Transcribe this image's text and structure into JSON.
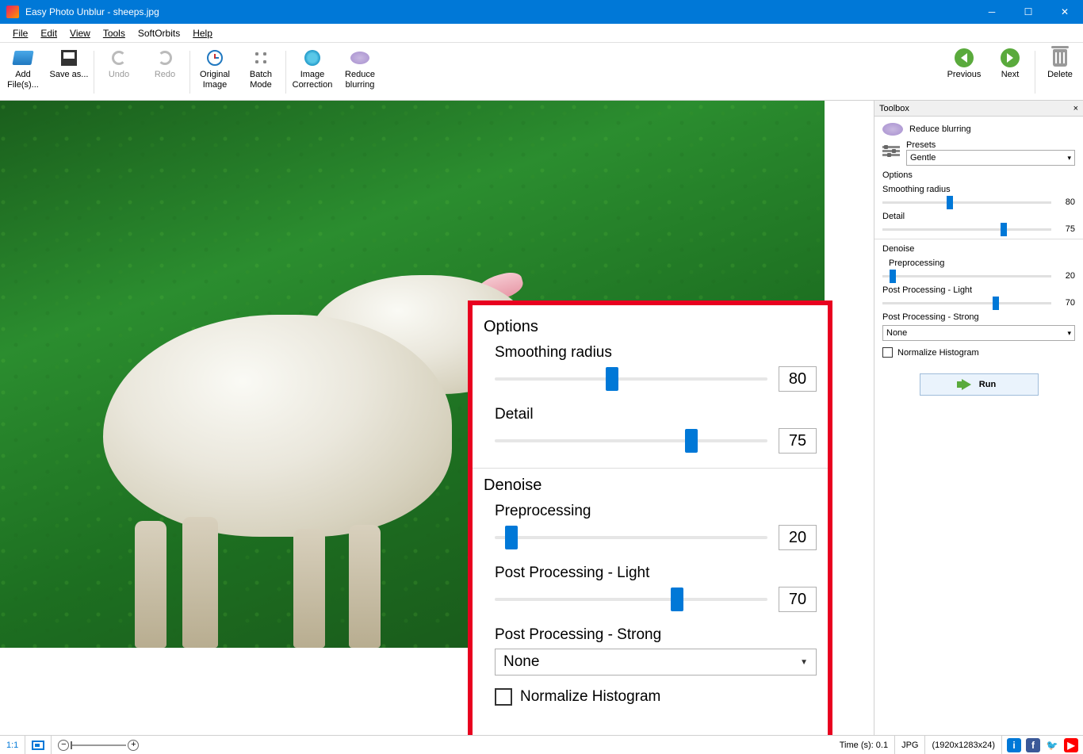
{
  "titlebar": {
    "title": "Easy Photo Unblur - sheeps.jpg"
  },
  "menu": [
    "File",
    "Edit",
    "View",
    "Tools",
    "SoftOrbits",
    "Help"
  ],
  "toolbar": {
    "add": "Add File(s)...",
    "save": "Save as...",
    "undo": "Undo",
    "redo": "Redo",
    "original": "Original Image",
    "batch": "Batch Mode",
    "correction": "Image Correction",
    "blur": "Reduce blurring",
    "previous": "Previous",
    "next": "Next",
    "delete": "Delete"
  },
  "overlay": {
    "options_title": "Options",
    "smoothing_label": "Smoothing radius",
    "smoothing_value": "80",
    "detail_label": "Detail",
    "detail_value": "75",
    "denoise_title": "Denoise",
    "preprocessing_label": "Preprocessing",
    "preprocessing_value": "20",
    "pp_light_label": "Post Processing - Light",
    "pp_light_value": "70",
    "pp_strong_label": "Post Processing - Strong",
    "pp_strong_value": "None",
    "normalize_label": "Normalize Histogram"
  },
  "sidebar": {
    "title": "Toolbox",
    "tool_name": "Reduce blurring",
    "presets_label": "Presets",
    "preset_value": "Gentle",
    "options_hdr": "Options",
    "smoothing_label": "Smoothing radius",
    "smoothing_value": "80",
    "detail_label": "Detail",
    "detail_value": "75",
    "denoise_hdr": "Denoise",
    "preprocessing_label": "Preprocessing",
    "preprocessing_value": "20",
    "pp_light_label": "Post Processing - Light",
    "pp_light_value": "70",
    "pp_strong_label": "Post Processing - Strong",
    "pp_strong_value": "None",
    "normalize_label": "Normalize Histogram",
    "run_label": "Run"
  },
  "status": {
    "ratio": "1:1",
    "time": "Time (s): 0.1",
    "format": "JPG",
    "dims": "(1920x1283x24)"
  }
}
